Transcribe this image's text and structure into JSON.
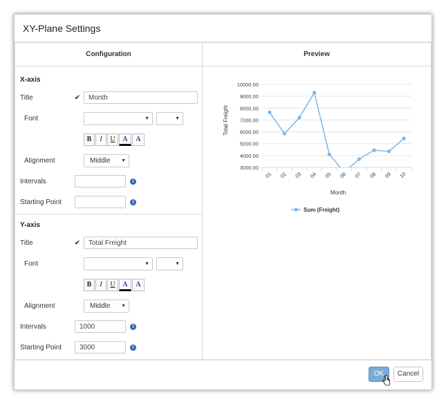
{
  "dialog": {
    "title": "XY-Plane Settings",
    "ok_label": "OK",
    "cancel_label": "Cancel"
  },
  "configuration": {
    "header": "Configuration",
    "x_axis": {
      "section_label": "X-axis",
      "title_label": "Title",
      "title_checked": true,
      "title_value": "Month",
      "font_label": "Font",
      "font_family": "",
      "font_size": "",
      "alignment_label": "Alignment",
      "alignment_value": "Middle",
      "intervals_label": "Intervals",
      "intervals_value": "",
      "starting_point_label": "Starting Point",
      "starting_point_value": ""
    },
    "y_axis": {
      "section_label": "Y-axis",
      "title_label": "Title",
      "title_checked": true,
      "title_value": "Total Freight",
      "font_label": "Font",
      "font_family": "",
      "font_size": "",
      "alignment_label": "Alignment",
      "alignment_value": "Middle",
      "intervals_label": "Intervals",
      "intervals_value": "1000",
      "starting_point_label": "Starting Point",
      "starting_point_value": "3000"
    },
    "format_buttons": {
      "bold": "B",
      "italic": "I",
      "underline": "U",
      "font_color": "A",
      "background_color": "A"
    }
  },
  "preview": {
    "header": "Preview"
  },
  "chart_data": {
    "type": "line",
    "x": [
      "01",
      "02",
      "03",
      "04",
      "05",
      "06",
      "07",
      "08",
      "09",
      "10"
    ],
    "series": [
      {
        "name": "Sum (Freight)",
        "values": [
          7650,
          5850,
          7200,
          9300,
          4100,
          2600,
          3700,
          4450,
          4350,
          5450
        ],
        "color": "#7cb5ec"
      }
    ],
    "xlabel": "Month",
    "ylabel": "Total Freight",
    "y_ticks": [
      "10000.00",
      "9000.00",
      "8000.00",
      "7000.00",
      "6000.00",
      "5000.00",
      "4000.00",
      "3000.00"
    ],
    "ylim": [
      3000,
      10000
    ],
    "grid": true,
    "legend": "bottom"
  },
  "colors": {
    "accent": "#7aaad5",
    "series": "#7cb5ec",
    "info": "#2e69a8"
  }
}
